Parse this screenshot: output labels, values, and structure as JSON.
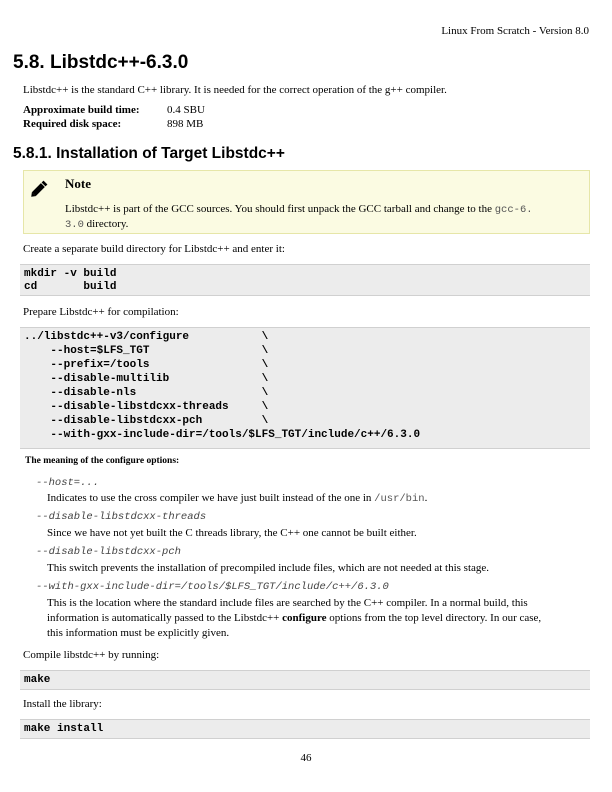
{
  "header": {
    "running_title": "Linux From Scratch - Version 8.0"
  },
  "section": {
    "title": "5.8. Libstdc++-6.3.0",
    "intro": "Libstdc++ is the standard C++ library. It is needed for the correct operation of the g++ compiler.",
    "info": [
      {
        "label": "Approximate build time:",
        "value": "0.4 SBU"
      },
      {
        "label": "Required disk space:",
        "value": "898 MB"
      }
    ]
  },
  "subsection": {
    "title": "5.8.1. Installation of Target Libstdc++"
  },
  "note": {
    "icon": "pencil-icon",
    "title": "Note",
    "text_before": "Libstdc++ is part of the GCC sources. You should first unpack the GCC tarball and change to the ",
    "code_part1": "gcc-6.",
    "code_part2": "3.0",
    "text_after": " directory."
  },
  "steps": {
    "create_dir_text": "Create a separate build directory for Libstdc++ and enter it:",
    "create_dir_code": [
      "mkdir -v build",
      "cd       build"
    ],
    "prepare_text": "Prepare Libstdc++ for compilation:",
    "prepare_code": [
      "../libstdc++-v3/configure           \\",
      "    --host=$LFS_TGT                 \\",
      "    --prefix=/tools                 \\",
      "    --disable-multilib              \\",
      "    --disable-nls                   \\",
      "    --disable-libstdcxx-threads     \\",
      "    --disable-libstdcxx-pch         \\",
      "    --with-gxx-include-dir=/tools/$LFS_TGT/include/c++/6.3.0"
    ],
    "options_heading": "The meaning of the configure options:",
    "options": [
      {
        "term": "--host=...",
        "desc": "Indicates to use the cross compiler we have just built instead of the one in ",
        "desc_code": "/usr/bin",
        "desc_end": "."
      },
      {
        "term": "--disable-libstdcxx-threads",
        "desc": "Since we have not yet built the C threads library, the C++ one cannot be built either."
      },
      {
        "term": "--disable-libstdcxx-pch",
        "desc": "This switch prevents the installation of precompiled include files, which are not needed at this stage."
      },
      {
        "term": "--with-gxx-include-dir=/tools/$LFS_TGT/include/c++/6.3.0",
        "desc_line1": "This is the location where the standard include files are searched by the C++ compiler. In a normal build, this",
        "desc_line2_a": "information is automatically passed to the Libstdc++ ",
        "desc_line2_bold": "configure",
        "desc_line2_b": " options from the top level directory. In our case,",
        "desc_line3": "this information must be explicitly given."
      }
    ],
    "compile_text": "Compile libstdc++ by running:",
    "compile_code": "make",
    "install_text": "Install the library:",
    "install_code": "make install"
  },
  "footer": {
    "page_number": "46"
  }
}
